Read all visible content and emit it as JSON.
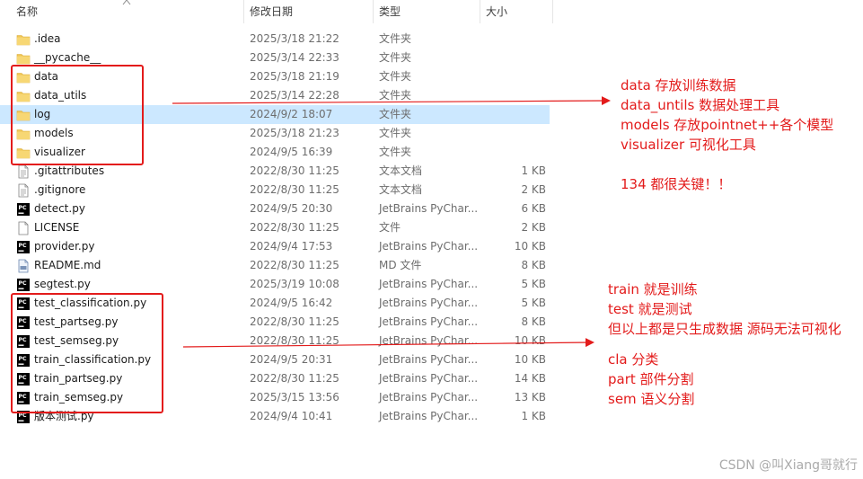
{
  "columns": {
    "name": "名称",
    "date": "修改日期",
    "type": "类型",
    "size": "大小"
  },
  "files": [
    {
      "name": ".idea",
      "date": "2025/3/18 21:22",
      "type": "文件夹",
      "size": "",
      "icon": "folder-icon"
    },
    {
      "name": "__pycache__",
      "date": "2025/3/14 22:33",
      "type": "文件夹",
      "size": "",
      "icon": "folder-icon"
    },
    {
      "name": "data",
      "date": "2025/3/18 21:19",
      "type": "文件夹",
      "size": "",
      "icon": "folder-icon"
    },
    {
      "name": "data_utils",
      "date": "2025/3/14 22:28",
      "type": "文件夹",
      "size": "",
      "icon": "folder-icon"
    },
    {
      "name": "log",
      "date": "2024/9/2 18:07",
      "type": "文件夹",
      "size": "",
      "icon": "folder-icon",
      "selected": true
    },
    {
      "name": "models",
      "date": "2025/3/18 21:23",
      "type": "文件夹",
      "size": "",
      "icon": "folder-icon"
    },
    {
      "name": "visualizer",
      "date": "2024/9/5 16:39",
      "type": "文件夹",
      "size": "",
      "icon": "folder-icon"
    },
    {
      "name": ".gitattributes",
      "date": "2022/8/30 11:25",
      "type": "文本文档",
      "size": "1 KB",
      "icon": "text-file-icon"
    },
    {
      "name": ".gitignore",
      "date": "2022/8/30 11:25",
      "type": "文本文档",
      "size": "2 KB",
      "icon": "text-file-icon"
    },
    {
      "name": "detect.py",
      "date": "2024/9/5 20:30",
      "type": "JetBrains PyChar...",
      "size": "6 KB",
      "icon": "pycharm-file-icon"
    },
    {
      "name": "LICENSE",
      "date": "2022/8/30 11:25",
      "type": "文件",
      "size": "2 KB",
      "icon": "blank-file-icon"
    },
    {
      "name": "provider.py",
      "date": "2024/9/4 17:53",
      "type": "JetBrains PyChar...",
      "size": "10 KB",
      "icon": "pycharm-file-icon"
    },
    {
      "name": "README.md",
      "date": "2022/8/30 11:25",
      "type": "MD 文件",
      "size": "8 KB",
      "icon": "markdown-file-icon"
    },
    {
      "name": "segtest.py",
      "date": "2025/3/19 10:08",
      "type": "JetBrains PyChar...",
      "size": "5 KB",
      "icon": "pycharm-file-icon"
    },
    {
      "name": "test_classification.py",
      "date": "2024/9/5 16:42",
      "type": "JetBrains PyChar...",
      "size": "5 KB",
      "icon": "pycharm-file-icon"
    },
    {
      "name": "test_partseg.py",
      "date": "2022/8/30 11:25",
      "type": "JetBrains PyChar...",
      "size": "8 KB",
      "icon": "pycharm-file-icon"
    },
    {
      "name": "test_semseg.py",
      "date": "2022/8/30 11:25",
      "type": "JetBrains PyChar...",
      "size": "10 KB",
      "icon": "pycharm-file-icon"
    },
    {
      "name": "train_classification.py",
      "date": "2024/9/5 20:31",
      "type": "JetBrains PyChar...",
      "size": "10 KB",
      "icon": "pycharm-file-icon"
    },
    {
      "name": "train_partseg.py",
      "date": "2022/8/30 11:25",
      "type": "JetBrains PyChar...",
      "size": "14 KB",
      "icon": "pycharm-file-icon"
    },
    {
      "name": "train_semseg.py",
      "date": "2025/3/15 13:56",
      "type": "JetBrains PyChar...",
      "size": "13 KB",
      "icon": "pycharm-file-icon"
    },
    {
      "name": "版本测试.py",
      "date": "2024/9/4 10:41",
      "type": "JetBrains PyChar...",
      "size": "1 KB",
      "icon": "pycharm-file-icon"
    }
  ],
  "notes": {
    "top": [
      "data 存放训练数据",
      "data_untils 数据处理工具",
      "models 存放pointnet++各个模型",
      "visualizer 可视化工具",
      "",
      "134 都很关键！！"
    ],
    "bottom": [
      "train 就是训练",
      "test 就是测试",
      "但以上都是只生成数据 源码无法可视化",
      "",
      "cla 分类",
      "part 部件分割",
      "sem 语义分割"
    ]
  },
  "watermark": "CSDN @叫Xiang哥就行",
  "colors": {
    "annotation": "#e31b1b",
    "selection": "#cce8ff",
    "folder": "#f0c656"
  }
}
